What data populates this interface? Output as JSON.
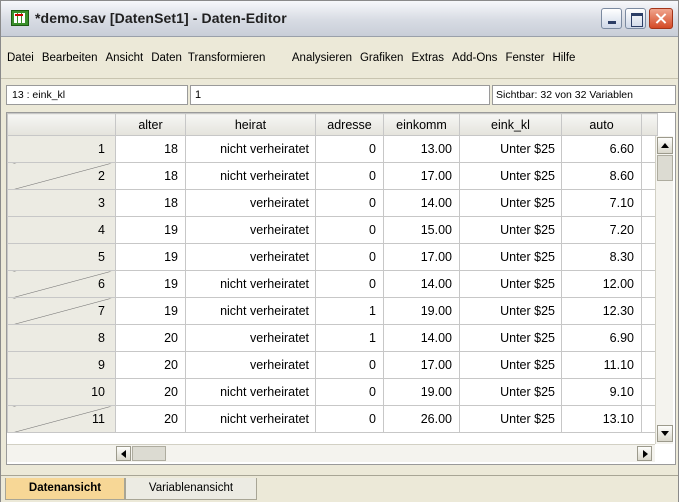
{
  "window": {
    "title": "*demo.sav [DatenSet1] - Daten-Editor"
  },
  "menu": [
    {
      "label": "Datei"
    },
    {
      "label": "Bearbeiten"
    },
    {
      "label": "Ansicht"
    },
    {
      "label": "Daten"
    },
    {
      "label": "Transformieren"
    },
    {
      "label": "Analysieren"
    },
    {
      "label": "Grafiken"
    },
    {
      "label": "Extras"
    },
    {
      "label": "Add-Ons"
    },
    {
      "label": "Fenster"
    },
    {
      "label": "Hilfe"
    }
  ],
  "cellbar": {
    "reference": "13 : eink_kl",
    "value": "1",
    "visible": "Sichtbar: 32 von 32 Variablen"
  },
  "grid": {
    "columns": [
      "alter",
      "heirat",
      "adresse",
      "einkomm",
      "eink_kl",
      "auto"
    ],
    "rows": [
      {
        "n": "1",
        "alter": "18",
        "heirat": "nicht verheiratet",
        "adresse": "0",
        "einkomm": "13.00",
        "eink_kl": "Unter $25",
        "auto": "6.60"
      },
      {
        "n": "2",
        "alter": "18",
        "heirat": "nicht verheiratet",
        "adresse": "0",
        "einkomm": "17.00",
        "eink_kl": "Unter $25",
        "auto": "8.60"
      },
      {
        "n": "3",
        "alter": "18",
        "heirat": "verheiratet",
        "adresse": "0",
        "einkomm": "14.00",
        "eink_kl": "Unter $25",
        "auto": "7.10"
      },
      {
        "n": "4",
        "alter": "19",
        "heirat": "verheiratet",
        "adresse": "0",
        "einkomm": "15.00",
        "eink_kl": "Unter $25",
        "auto": "7.20"
      },
      {
        "n": "5",
        "alter": "19",
        "heirat": "verheiratet",
        "adresse": "0",
        "einkomm": "17.00",
        "eink_kl": "Unter $25",
        "auto": "8.30"
      },
      {
        "n": "6",
        "alter": "19",
        "heirat": "nicht verheiratet",
        "adresse": "0",
        "einkomm": "14.00",
        "eink_kl": "Unter $25",
        "auto": "12.00"
      },
      {
        "n": "7",
        "alter": "19",
        "heirat": "nicht verheiratet",
        "adresse": "1",
        "einkomm": "19.00",
        "eink_kl": "Unter $25",
        "auto": "12.30"
      },
      {
        "n": "8",
        "alter": "20",
        "heirat": "verheiratet",
        "adresse": "1",
        "einkomm": "14.00",
        "eink_kl": "Unter $25",
        "auto": "6.90"
      },
      {
        "n": "9",
        "alter": "20",
        "heirat": "verheiratet",
        "adresse": "0",
        "einkomm": "17.00",
        "eink_kl": "Unter $25",
        "auto": "11.10"
      },
      {
        "n": "10",
        "alter": "20",
        "heirat": "nicht verheiratet",
        "adresse": "0",
        "einkomm": "19.00",
        "eink_kl": "Unter $25",
        "auto": "9.10"
      },
      {
        "n": "11",
        "alter": "20",
        "heirat": "nicht verheiratet",
        "adresse": "0",
        "einkomm": "26.00",
        "eink_kl": "Unter $25",
        "auto": "13.10"
      }
    ]
  },
  "tabs": [
    {
      "label": "Datenansicht",
      "active": true
    },
    {
      "label": "Variablenansicht",
      "active": false
    }
  ]
}
